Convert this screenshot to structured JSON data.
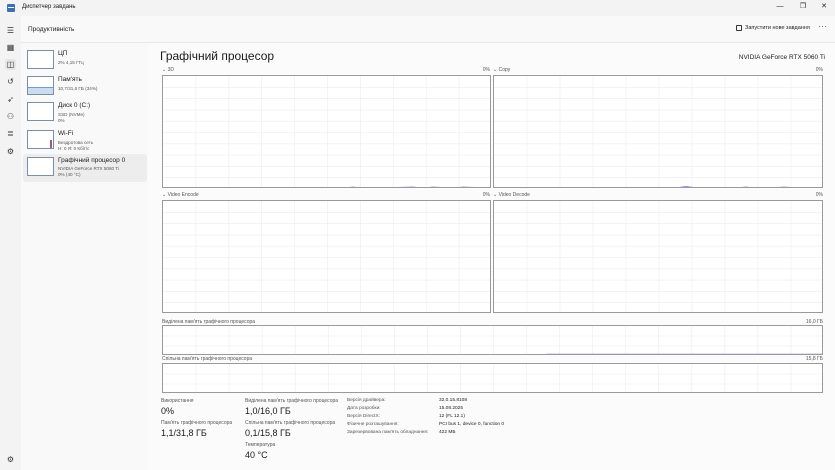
{
  "window": {
    "title": "Диспетчер завдань",
    "controls": [
      "—",
      "❐",
      "✕"
    ]
  },
  "header": {
    "page_title": "Продуктивність",
    "run_task_label": "Запустити нове завдання",
    "more": "···"
  },
  "devices": [
    {
      "name": "ЦП",
      "sub1": "2% 4,15 ГГц",
      "sub2": ""
    },
    {
      "name": "Пам'ять",
      "sub1": "10,7/31,6 ГБ (34%)",
      "sub2": ""
    },
    {
      "name": "Диск 0 (C:)",
      "sub1": "SSD (NVMe)",
      "sub2": "0%"
    },
    {
      "name": "Wi-Fi",
      "sub1": "Бездротова сеть",
      "sub2": "Н: 0 Я: 0 Кбіт/с"
    },
    {
      "name": "Графічний процесор 0",
      "sub1": "NVIDIA GeForce RTX 5060 Ti",
      "sub2": "0% (40 °C)"
    }
  ],
  "gpu": {
    "title": "Графічний процесор",
    "model": "NVIDIA GeForce RTX 5060 Ti",
    "graphs": [
      {
        "label": "3D",
        "pct": "0%"
      },
      {
        "label": "Copy",
        "pct": "0%"
      },
      {
        "label": "Video Encode",
        "pct": "0%"
      },
      {
        "label": "Video Decode",
        "pct": "0%"
      }
    ],
    "dedicated_label": "Виділена пам'ять графічного процесора",
    "dedicated_max": "16,0 ГБ",
    "shared_label": "Спільна пам'ять графічного процесора",
    "shared_max": "15,8 ГБ"
  },
  "stats": {
    "utilization_label": "Використання",
    "utilization_value": "0%",
    "dedicated_mem_label": "Виділена пам'ять графічного процесора",
    "dedicated_mem_value": "1,0/16,0 ГБ",
    "gpu_mem_label": "Пам'ять графічного процесора",
    "gpu_mem_value": "1,1/31,8 ГБ",
    "shared_mem_label": "Спільна пам'ять графічного процесора",
    "shared_mem_value": "0,1/15,8 ГБ",
    "temp_label": "Температура",
    "temp_value": "40 °C"
  },
  "details": [
    {
      "key": "Версія драйвера:",
      "value": "32.0.15.8108"
    },
    {
      "key": "Дата розробки:",
      "value": "15.08.2025"
    },
    {
      "key": "Версія DirectX:",
      "value": "12 (FL 12.1)"
    },
    {
      "key": "Фізичне розташування:",
      "value": "PCI bus 1, device 0, function 0"
    },
    {
      "key": "Зарезервована пам'ять обладнання:",
      "value": "422 МБ"
    }
  ],
  "colors": {
    "graph_line": "#9b6ad6",
    "graph_fill": "#e6dcf5",
    "grid": "#ececec"
  }
}
